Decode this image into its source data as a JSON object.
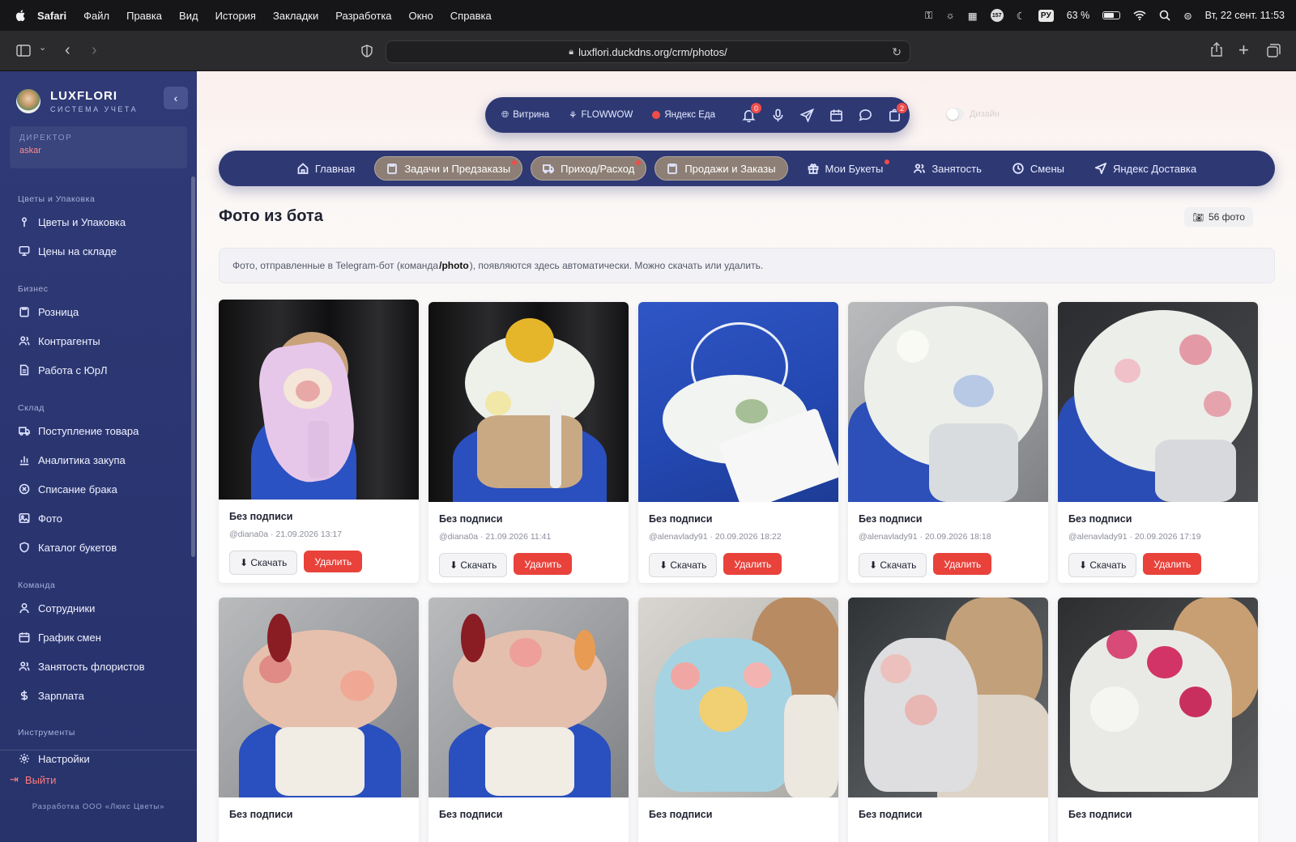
{
  "menubar": {
    "app": "Safari",
    "items": [
      "Файл",
      "Правка",
      "Вид",
      "История",
      "Закладки",
      "Разработка",
      "Окно",
      "Справка"
    ],
    "input_lang": "РУ",
    "battery": "63 %",
    "badge": "157",
    "datetime": "Вт, 22 сент.  11:53"
  },
  "browser": {
    "url": "luxflori.duckdns.org/crm/photos/"
  },
  "sidebar": {
    "brand_name": "LUXFLORI",
    "brand_sub": "СИСТЕМА УЧЕТА",
    "role": "ДИРЕКТОР",
    "user": "askar",
    "sections": [
      {
        "title": "Цветы и Упаковка",
        "items": [
          "Цветы и Упаковка",
          "Цены на складе"
        ]
      },
      {
        "title": "Бизнес",
        "items": [
          "Розница",
          "Контрагенты",
          "Работа с ЮрЛ"
        ]
      },
      {
        "title": "Склад",
        "items": [
          "Поступление товара",
          "Аналитика закупа",
          "Списание брака",
          "Фото",
          "Каталог букетов"
        ]
      },
      {
        "title": "Команда",
        "items": [
          "Сотрудники",
          "График смен",
          "Занятость флористов",
          "Зарплата"
        ]
      },
      {
        "title": "Инструменты",
        "items": []
      }
    ],
    "settings": "Настройки",
    "logout": "Выйти",
    "credits": "Разработка ООО «Люкс Цветы»"
  },
  "top_pill": {
    "links": [
      "Витрина",
      "FLOWWOW",
      "Яндекс Еда"
    ],
    "notifications_count": "0",
    "orders_count": "2",
    "theme_label": "Дизайн"
  },
  "nav": {
    "tabs": [
      "Главная",
      "Задачи и Предзаказы",
      "Приход/Расход",
      "Продажи и Заказы",
      "Мои Букеты",
      "Занятость",
      "Смены",
      "Яндекс Доставка"
    ]
  },
  "page": {
    "title": "Фото из бота",
    "count": "56 фото",
    "info_before": "Фото, отправленные в Telegram-бот (команда ",
    "info_cmd": "/photo",
    "info_after": "), появляются здесь автоматически. Можно скачать или удалить."
  },
  "buttons": {
    "download": "⬇ Скачать",
    "delete": "Удалить"
  },
  "photos": [
    {
      "caption": "Без подписи",
      "meta": "@diana0a · 21.09.2026 13:17"
    },
    {
      "caption": "Без подписи",
      "meta": "@diana0a · 21.09.2026 11:41"
    },
    {
      "caption": "Без подписи",
      "meta": "@alenavlady91 · 20.09.2026 18:22"
    },
    {
      "caption": "Без подписи",
      "meta": "@alenavlady91 · 20.09.2026 18:18"
    },
    {
      "caption": "Без подписи",
      "meta": "@alenavlady91 · 20.09.2026 17:19"
    },
    {
      "caption": "Без подписи",
      "meta": ""
    },
    {
      "caption": "Без подписи",
      "meta": ""
    },
    {
      "caption": "Без подписи",
      "meta": ""
    },
    {
      "caption": "Без подписи",
      "meta": ""
    },
    {
      "caption": "Без подписи",
      "meta": ""
    }
  ],
  "colors": {
    "sidebar": "#2f3a76",
    "navbar": "#2e3974",
    "accent_red": "#e8423b",
    "highlight_tab": "#8d7f75"
  }
}
